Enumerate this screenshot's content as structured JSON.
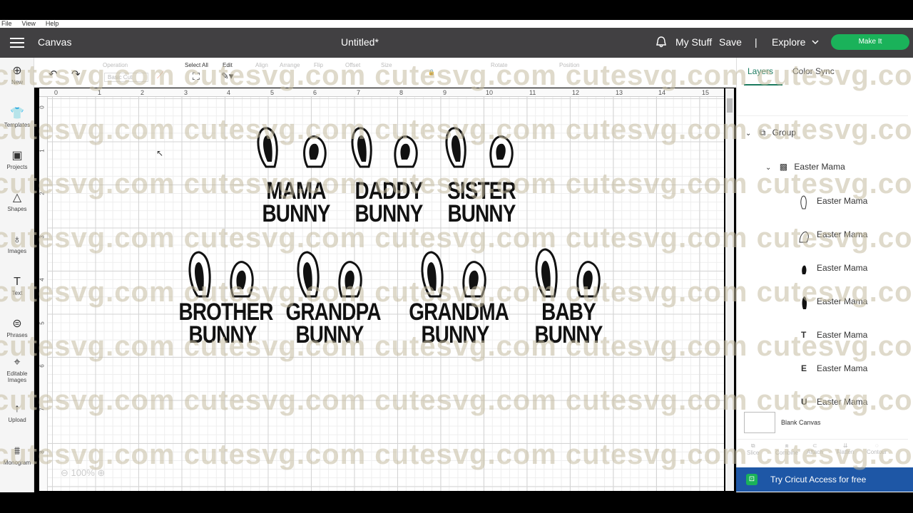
{
  "menubar": {
    "file": "File",
    "view": "View",
    "help": "Help"
  },
  "header": {
    "canvas": "Canvas",
    "title": "Untitled*",
    "mystuff": "My Stuff",
    "save": "Save",
    "divider": "|",
    "explore": "Explore",
    "make_it": "Make It"
  },
  "leftbar": {
    "new": "New",
    "templates": "Templates",
    "projects": "Projects",
    "shapes": "Shapes",
    "images": "Images",
    "text": "Text",
    "phrases": "Phrases",
    "editable_images_1": "Editable",
    "editable_images_2": "Images",
    "upload": "Upload",
    "monogram": "Monogram"
  },
  "toolbar": {
    "operation": "Operation",
    "operation_value": "Basic Cut",
    "select_all": "Select All",
    "edit": "Edit",
    "align": "Align",
    "arrange": "Arrange",
    "flip": "Flip",
    "offset": "Offset",
    "size": "Size",
    "rotate": "Rotate",
    "position": "Position"
  },
  "ruler_h": [
    "0",
    "1",
    "2",
    "3",
    "4",
    "5",
    "6",
    "7",
    "8",
    "9",
    "10",
    "11",
    "12",
    "13",
    "14",
    "15"
  ],
  "ruler_v": [
    "0",
    "1",
    "2",
    "3",
    "4",
    "5",
    "6",
    "7",
    "8"
  ],
  "zoom": "100%",
  "designs": [
    {
      "line1": "MAMA",
      "line2": "BUNNY"
    },
    {
      "line1": "DADDY",
      "line2": "BUNNY"
    },
    {
      "line1": "SISTER",
      "line2": "BUNNY"
    },
    {
      "line1": "BROTHER",
      "line2": "BUNNY"
    },
    {
      "line1": "GRANDPA",
      "line2": "BUNNY"
    },
    {
      "line1": "GRANDMA",
      "line2": "BUNNY"
    },
    {
      "line1": "BABY",
      "line2": "BUNNY"
    }
  ],
  "right_panel": {
    "tab_layers": "Layers",
    "tab_color_sync": "Color Sync",
    "group": "Group",
    "sub_group": "Easter Mama",
    "layers": [
      "Easter Mama",
      "Easter Mama",
      "Easter Mama",
      "Easter Mama",
      "Easter Mama",
      "Easter Mama",
      "Easter Mama"
    ],
    "layer_glyphs": [
      "ear-outline",
      "ear-outline-2",
      "ear-filled",
      "ear-filled-2",
      "T",
      "E",
      "U"
    ],
    "blank_canvas": "Blank Canvas",
    "actions": [
      "Slice",
      "Combine",
      "Attach",
      "Flatten",
      "Contour"
    ],
    "promo": "Try Cricut Access for free"
  },
  "watermark": "cutesvg.com",
  "colors": {
    "header": "#414042",
    "make_it": "#1ab25a",
    "promo": "#1e57a6",
    "accent_tab": "#1a7a5e"
  }
}
